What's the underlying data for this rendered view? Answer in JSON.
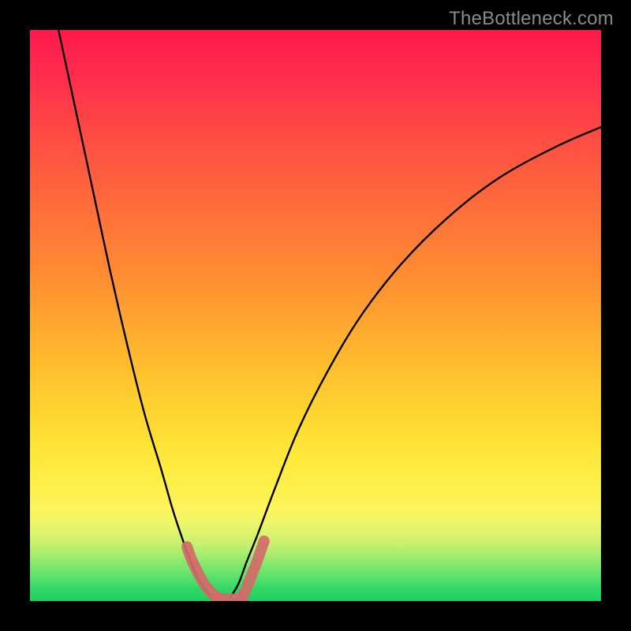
{
  "watermark": "TheBottleneck.com",
  "chart_data": {
    "type": "line",
    "title": "",
    "xlabel": "",
    "ylabel": "",
    "xlim": [
      0,
      100
    ],
    "ylim": [
      0,
      100
    ],
    "grid": false,
    "legend": false,
    "background": "rainbow-gradient",
    "series": [
      {
        "name": "left-curve",
        "color": "#000000",
        "x": [
          5,
          8,
          11,
          14,
          17,
          20,
          23,
          25,
          27,
          28.5,
          30,
          31.5
        ],
        "y": [
          100,
          86,
          72,
          58,
          45,
          33,
          23,
          16,
          10,
          6,
          3,
          1
        ]
      },
      {
        "name": "right-curve",
        "color": "#000000",
        "x": [
          35,
          36.5,
          38,
          40,
          43,
          47,
          52,
          58,
          65,
          73,
          82,
          92,
          100
        ],
        "y": [
          0.5,
          3,
          7,
          12,
          20,
          30,
          40,
          50,
          59,
          67,
          74,
          79.5,
          83
        ]
      },
      {
        "name": "highlight-left",
        "color": "#d46a6a",
        "x": [
          27.5,
          28.2,
          29,
          29.8,
          30.5,
          31.3,
          32,
          32.8
        ],
        "y": [
          9.5,
          7.5,
          5.8,
          4.2,
          3,
          2,
          1.2,
          0.7
        ]
      },
      {
        "name": "highlight-bottom",
        "color": "#d46a6a",
        "x": [
          32.8,
          34,
          35,
          36,
          37.2
        ],
        "y": [
          0.5,
          0.4,
          0.35,
          0.4,
          0.6
        ]
      },
      {
        "name": "highlight-right",
        "color": "#d46a6a",
        "x": [
          37.2,
          38,
          38.8,
          39.6,
          40.3,
          41
        ],
        "y": [
          0.8,
          2.5,
          4.5,
          6.5,
          8.5,
          10.5
        ]
      }
    ]
  }
}
